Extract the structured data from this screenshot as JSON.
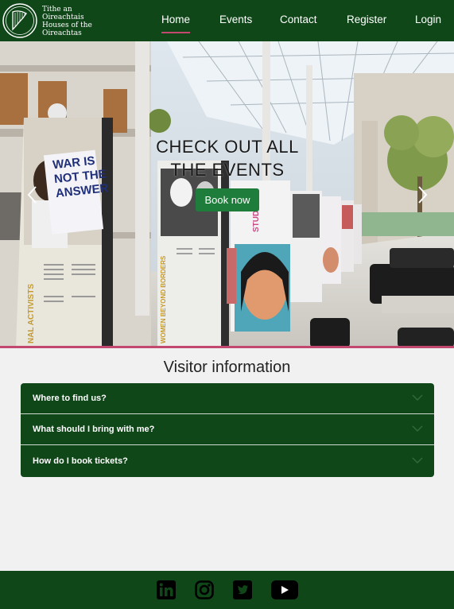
{
  "logo": {
    "line1": "Tithe an",
    "line2": "Oireachtais",
    "line3": "Houses of the",
    "line4": "Oireachtas"
  },
  "nav": {
    "home": "Home",
    "events": "Events",
    "contact": "Contact",
    "register": "Register",
    "login": "Login"
  },
  "hero": {
    "title_line1": "CHECK OUT ALL",
    "title_line2": "THE EVENTS",
    "button": "Book now",
    "poster1_text1": "WAR IS",
    "poster1_text2": "NOT THE",
    "poster1_text3": "ANSWER",
    "poster_side1": "NAL ACTIVISTS",
    "poster_side2": "WOMEN BEYOND BORDERS",
    "poster_side3": "STUDENTS"
  },
  "visitor": {
    "title": "Visitor information",
    "items": [
      "Where to find us?",
      "What should I bring with me?",
      "How do I book tickets?"
    ]
  },
  "colors": {
    "brand_green": "#104719",
    "button_green": "#1e7d3b",
    "accent_pink": "#c2486f",
    "page_bg": "#f2f1f1"
  },
  "icons": {
    "prev": "chevron-left-icon",
    "next": "chevron-right-icon",
    "accordion": "chevron-down-icon",
    "social": [
      "linkedin-icon",
      "instagram-icon",
      "twitter-icon",
      "youtube-icon"
    ]
  }
}
